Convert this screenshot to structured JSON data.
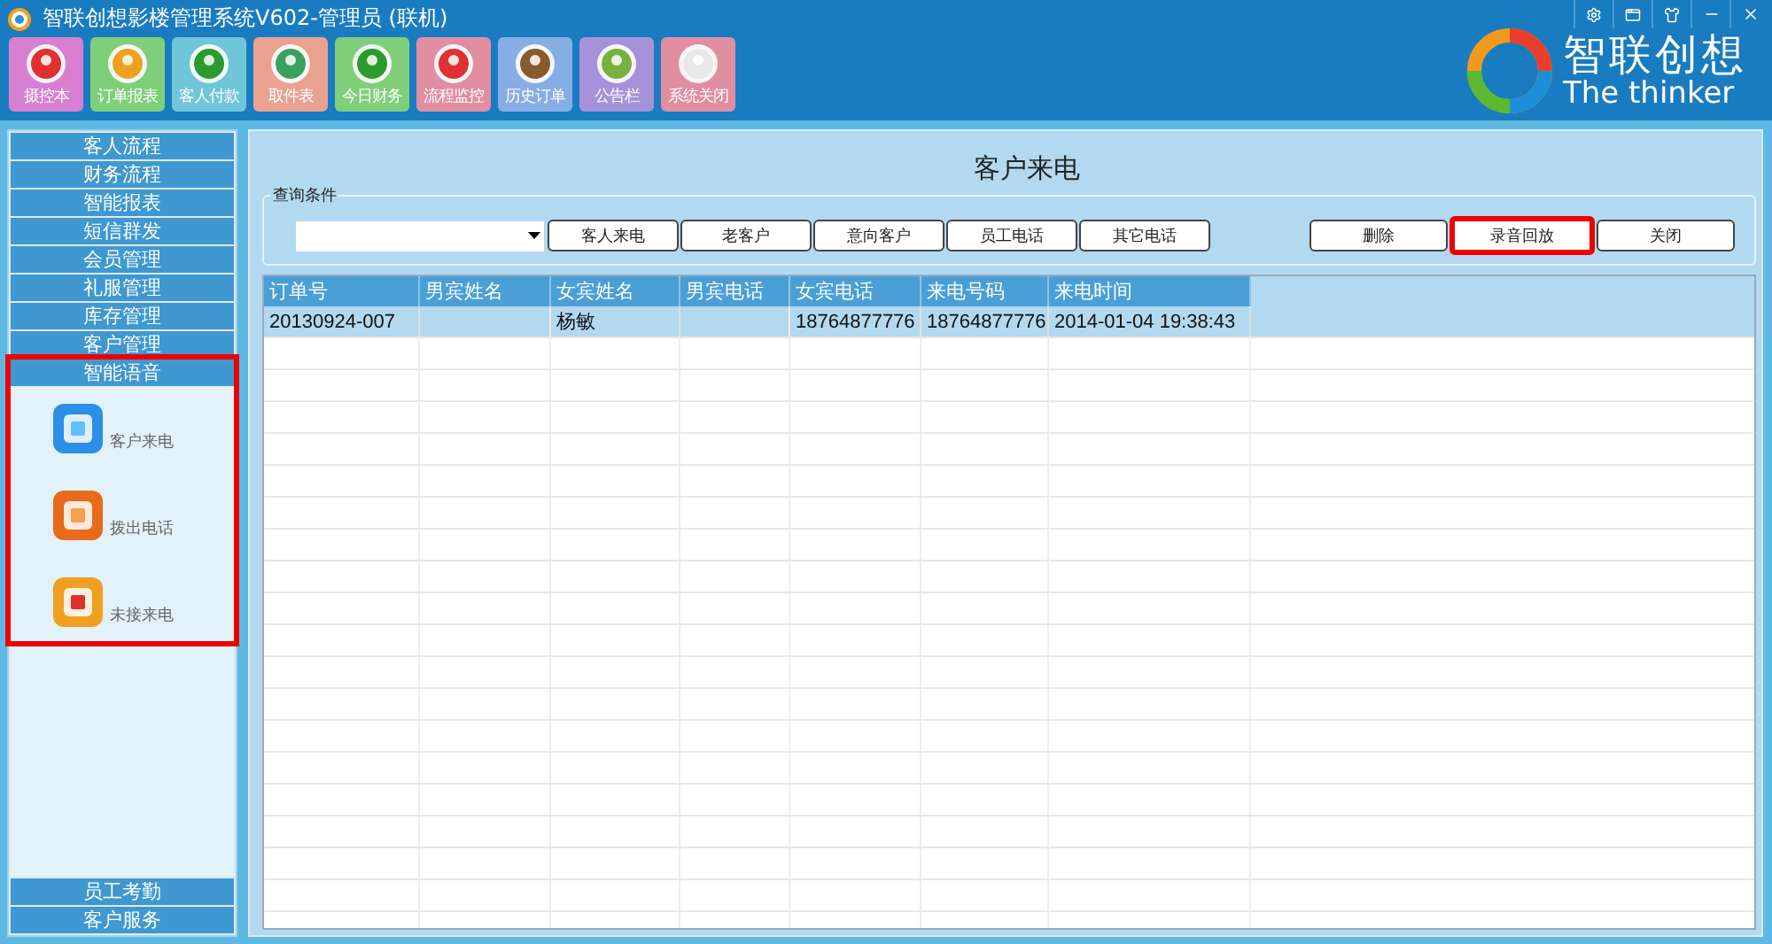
{
  "window": {
    "title": "智联创想影楼管理系统V602-管理员 (联机)"
  },
  "toolbar": [
    {
      "label": "摄控本",
      "color": "#d77fd0"
    },
    {
      "label": "订单报表",
      "color": "#7fcf7a"
    },
    {
      "label": "客人付款",
      "color": "#6fc6d8"
    },
    {
      "label": "取件表",
      "color": "#e9a290"
    },
    {
      "label": "今日财务",
      "color": "#7fcf7a"
    },
    {
      "label": "流程监控",
      "color": "#e08ea0"
    },
    {
      "label": "历史订单",
      "color": "#86aee4"
    },
    {
      "label": "公告栏",
      "color": "#a592d8"
    },
    {
      "label": "系统关闭",
      "color": "#e08ea0"
    }
  ],
  "logo": {
    "name": "智联创想",
    "tagline": "The thinker"
  },
  "sidebar": {
    "items": [
      {
        "label": "客人流程"
      },
      {
        "label": "财务流程"
      },
      {
        "label": "智能报表"
      },
      {
        "label": "短信群发"
      },
      {
        "label": "会员管理"
      },
      {
        "label": "礼服管理"
      },
      {
        "label": "库存管理"
      },
      {
        "label": "客户管理"
      },
      {
        "label": "智能语音",
        "highlighted": true,
        "children": [
          {
            "label": "客户来电"
          },
          {
            "label": "拨出电话"
          },
          {
            "label": "未接来电"
          }
        ]
      },
      {
        "label": "员工考勤"
      },
      {
        "label": "客户服务"
      }
    ]
  },
  "main": {
    "title": "客户来电",
    "filter": {
      "legend": "查询条件",
      "buttons": [
        {
          "label": "客人来电"
        },
        {
          "label": "老客户"
        },
        {
          "label": "意向客户"
        },
        {
          "label": "员工电话"
        },
        {
          "label": "其它电话"
        }
      ]
    },
    "actions": [
      {
        "label": "删除",
        "highlighted": false
      },
      {
        "label": "录音回放",
        "highlighted": true
      },
      {
        "label": "关闭",
        "highlighted": false
      }
    ],
    "table": {
      "columns": [
        "订单号",
        "男宾姓名",
        "女宾姓名",
        "男宾电话",
        "女宾电话",
        "来电号码",
        "来电时间"
      ],
      "rows": [
        {
          "selected": true,
          "cells": [
            "20130924-007",
            "",
            "杨敏",
            "",
            "18764877776",
            "18764877776",
            "2014-01-04 19:38:43"
          ]
        }
      ]
    }
  }
}
